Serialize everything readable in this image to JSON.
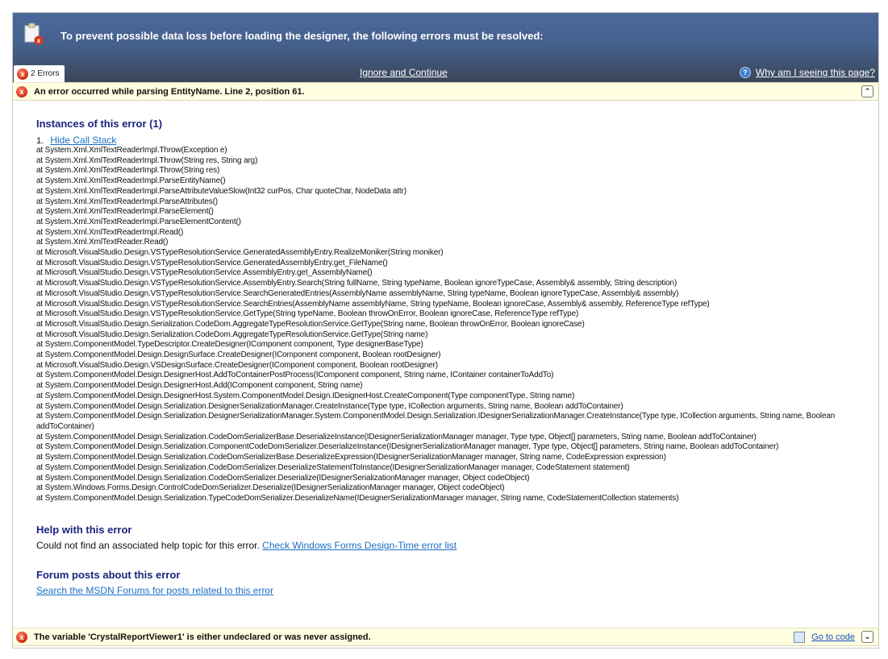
{
  "header": {
    "title": "To prevent possible data loss before loading the designer, the following errors must be resolved:",
    "error_tab_label": "2 Errors",
    "ignore_link": "Ignore and Continue",
    "why_link": "Why am I seeing this page?"
  },
  "errors": [
    {
      "message": "An error occurred while parsing EntityName. Line 2, position 61.",
      "instances_heading": "Instances of this error (1)",
      "instance_number": "1.",
      "hide_call_stack": "Hide Call Stack",
      "stack": [
        "at System.Xml.XmlTextReaderImpl.Throw(Exception e)",
        "at System.Xml.XmlTextReaderImpl.Throw(String res, String arg)",
        "at System.Xml.XmlTextReaderImpl.Throw(String res)",
        "at System.Xml.XmlTextReaderImpl.ParseEntityName()",
        "at System.Xml.XmlTextReaderImpl.ParseAttributeValueSlow(Int32 curPos, Char quoteChar, NodeData attr)",
        "at System.Xml.XmlTextReaderImpl.ParseAttributes()",
        "at System.Xml.XmlTextReaderImpl.ParseElement()",
        "at System.Xml.XmlTextReaderImpl.ParseElementContent()",
        "at System.Xml.XmlTextReaderImpl.Read()",
        "at System.Xml.XmlTextReader.Read()",
        "at Microsoft.VisualStudio.Design.VSTypeResolutionService.GeneratedAssemblyEntry.RealizeMoniker(String moniker)",
        "at Microsoft.VisualStudio.Design.VSTypeResolutionService.GeneratedAssemblyEntry.get_FileName()",
        "at Microsoft.VisualStudio.Design.VSTypeResolutionService.AssemblyEntry.get_AssemblyName()",
        "at Microsoft.VisualStudio.Design.VSTypeResolutionService.AssemblyEntry.Search(String fullName, String typeName, Boolean ignoreTypeCase, Assembly& assembly, String description)",
        "at Microsoft.VisualStudio.Design.VSTypeResolutionService.SearchGeneratedEntries(AssemblyName assemblyName, String typeName, Boolean ignoreTypeCase, Assembly& assembly)",
        "at Microsoft.VisualStudio.Design.VSTypeResolutionService.SearchEntries(AssemblyName assemblyName, String typeName, Boolean ignoreCase, Assembly& assembly, ReferenceType refType)",
        "at Microsoft.VisualStudio.Design.VSTypeResolutionService.GetType(String typeName, Boolean throwOnError, Boolean ignoreCase, ReferenceType refType)",
        "at Microsoft.VisualStudio.Design.Serialization.CodeDom.AggregateTypeResolutionService.GetType(String name, Boolean throwOnError, Boolean ignoreCase)",
        "at Microsoft.VisualStudio.Design.Serialization.CodeDom.AggregateTypeResolutionService.GetType(String name)",
        "at System.ComponentModel.TypeDescriptor.CreateDesigner(IComponent component, Type designerBaseType)",
        "at System.ComponentModel.Design.DesignSurface.CreateDesigner(IComponent component, Boolean rootDesigner)",
        "at Microsoft.VisualStudio.Design.VSDesignSurface.CreateDesigner(IComponent component, Boolean rootDesigner)",
        "at System.ComponentModel.Design.DesignerHost.AddToContainerPostProcess(IComponent component, String name, IContainer containerToAddTo)",
        "at System.ComponentModel.Design.DesignerHost.Add(IComponent component, String name)",
        "at System.ComponentModel.Design.DesignerHost.System.ComponentModel.Design.IDesignerHost.CreateComponent(Type componentType, String name)",
        "at System.ComponentModel.Design.Serialization.DesignerSerializationManager.CreateInstance(Type type, ICollection arguments, String name, Boolean addToContainer)",
        "at System.ComponentModel.Design.Serialization.DesignerSerializationManager.System.ComponentModel.Design.Serialization.IDesignerSerializationManager.CreateInstance(Type type, ICollection arguments, String name, Boolean addToContainer)",
        "at System.ComponentModel.Design.Serialization.CodeDomSerializerBase.DeserializeInstance(IDesignerSerializationManager manager, Type type, Object[] parameters, String name, Boolean addToContainer)",
        "at System.ComponentModel.Design.Serialization.ComponentCodeDomSerializer.DeserializeInstance(IDesignerSerializationManager manager, Type type, Object[] parameters, String name, Boolean addToContainer)",
        "at System.ComponentModel.Design.Serialization.CodeDomSerializerBase.DeserializeExpression(IDesignerSerializationManager manager, String name, CodeExpression expression)",
        "at System.ComponentModel.Design.Serialization.CodeDomSerializer.DeserializeStatementToInstance(IDesignerSerializationManager manager, CodeStatement statement)",
        "at System.ComponentModel.Design.Serialization.CodeDomSerializer.Deserialize(IDesignerSerializationManager manager, Object codeObject)",
        "at System.Windows.Forms.Design.ControlCodeDomSerializer.Deserialize(IDesignerSerializationManager manager, Object codeObject)",
        "at System.ComponentModel.Design.Serialization.TypeCodeDomSerializer.DeserializeName(IDesignerSerializationManager manager, String name, CodeStatementCollection statements)"
      ],
      "help_heading": "Help with this error",
      "help_text": "Could not find an associated help topic for this error.",
      "help_link": "Check Windows Forms Design-Time error list",
      "forum_heading": "Forum posts about this error",
      "forum_link": "Search the MSDN Forums for posts related to this error"
    },
    {
      "message": "The variable 'CrystalReportViewer1' is either undeclared or was never assigned.",
      "go_to_code": "Go to code"
    }
  ]
}
